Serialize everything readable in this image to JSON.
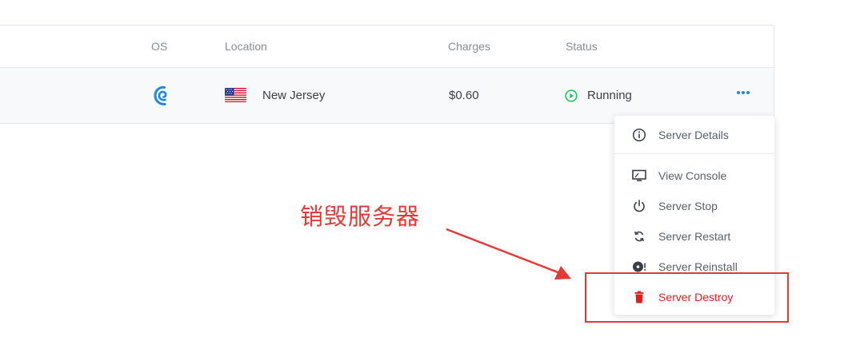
{
  "table": {
    "headers": {
      "os": "OS",
      "location": "Location",
      "charges": "Charges",
      "status": "Status"
    },
    "row": {
      "os_icon": "debian-swirl-icon",
      "flag": "us-flag-icon",
      "location": "New Jersey",
      "charges": "$0.60",
      "status": "Running",
      "status_color": "#22c55e",
      "actions_icon": "more-dots-icon"
    }
  },
  "menu": {
    "items": [
      {
        "label": "Server Details",
        "icon": "info-icon"
      },
      {
        "label": "View Console",
        "icon": "monitor-icon"
      },
      {
        "label": "Server Stop",
        "icon": "power-icon"
      },
      {
        "label": "Server Restart",
        "icon": "restart-icon"
      },
      {
        "label": "Server Reinstall",
        "icon": "reinstall-disc-icon"
      },
      {
        "label": "Server Destroy",
        "icon": "trash-icon"
      }
    ],
    "destroy_color": "#e11d1d"
  },
  "annotation": {
    "text": "销毁服务器",
    "color": "#e53935"
  },
  "colors": {
    "accent": "#1e88e5",
    "border": "#e3e6ea"
  }
}
